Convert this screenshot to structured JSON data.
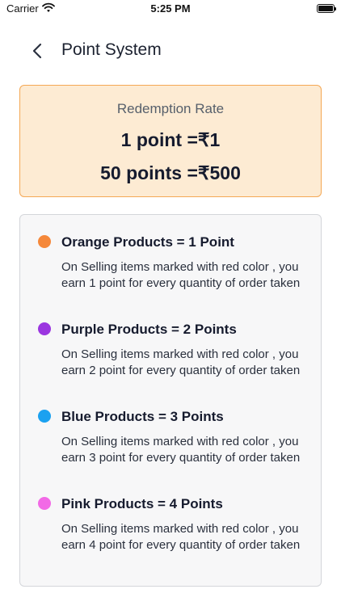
{
  "status_bar": {
    "carrier": "Carrier",
    "time": "5:25 PM"
  },
  "header": {
    "title": "Point System"
  },
  "redemption": {
    "title": "Redemption Rate",
    "line1": "1 point =₹1",
    "line2": "50 points =₹500"
  },
  "rules": [
    {
      "color": "#f5883a",
      "title": "Orange Products = 1 Point",
      "desc": "On Selling items marked with red color , you earn 1 point for every quantity of order taken"
    },
    {
      "color": "#9b36e0",
      "title": "Purple Products = 2 Points",
      "desc": "On Selling items marked with red color , you earn 2 point for every quantity of order taken"
    },
    {
      "color": "#1ba1f0",
      "title": "Blue Products = 3 Points",
      "desc": "On Selling items marked with red color , you earn 3 point for every quantity of order taken"
    },
    {
      "color": "#f26ae6",
      "title": "Pink Products = 4 Points",
      "desc": "On Selling items marked with red color , you earn 4 point for every quantity of order taken"
    }
  ]
}
